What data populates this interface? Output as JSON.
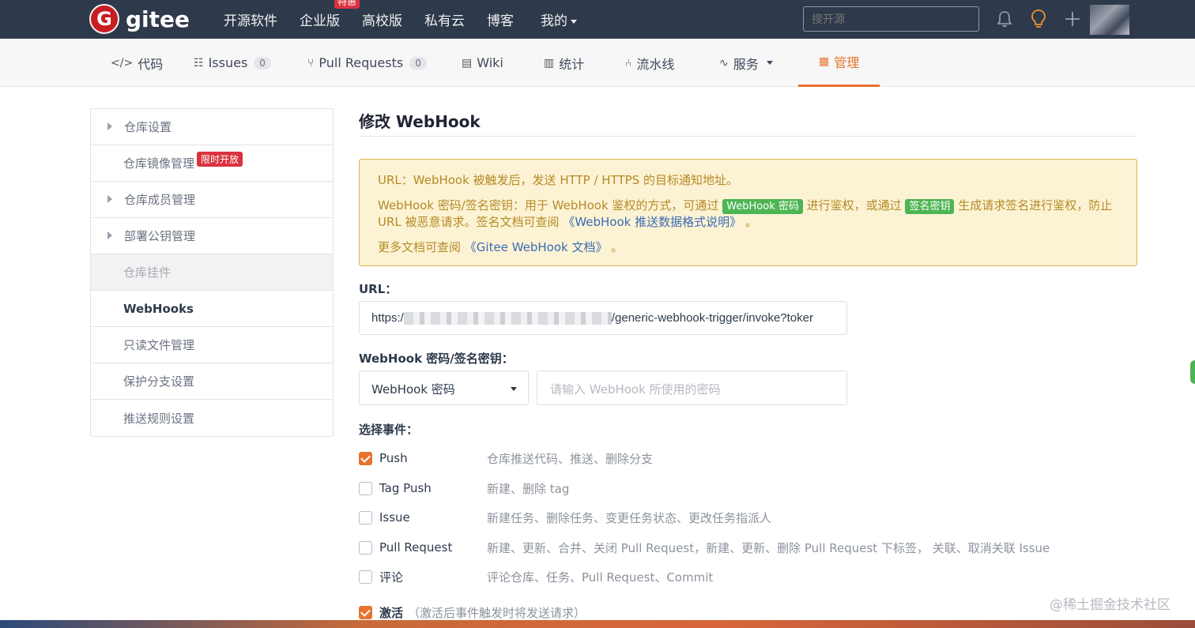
{
  "topbar": {
    "logo_letter": "G",
    "logo_text": "gitee",
    "nav": [
      "开源软件",
      "企业版",
      "高校版",
      "私有云",
      "博客",
      "我的"
    ],
    "hot_badge": "特惠",
    "search_placeholder": "搜开源"
  },
  "tabs": [
    {
      "icon": "</>",
      "label": "代码"
    },
    {
      "icon": "☷",
      "label": "Issues",
      "count": "0"
    },
    {
      "icon": "⑂",
      "label": "Pull Requests",
      "count": "0"
    },
    {
      "icon": "▤",
      "label": "Wiki"
    },
    {
      "icon": "▥",
      "label": "统计"
    },
    {
      "icon": "⑃",
      "label": "流水线"
    },
    {
      "icon": "∿",
      "label": "服务"
    },
    {
      "icon": "▦",
      "label": "管理"
    }
  ],
  "sidebar": {
    "items": [
      "仓库设置",
      "仓库镜像管理",
      "仓库成员管理",
      "部署公钥管理",
      "仓库挂件",
      "WebHooks",
      "只读文件管理",
      "保护分支设置",
      "推送规则设置"
    ],
    "limit_badge": "限时开放"
  },
  "main": {
    "title": "修改 WebHook",
    "notice": {
      "line1": "URL：WebHook 被触发后，发送 HTTP / HTTPS 的目标通知地址。",
      "line2_a": "WebHook 密码/签名密钥：用于 WebHook 鉴权的方式，可通过",
      "pill1": "WebHook 密码",
      "line2_b": "进行鉴权，或通过",
      "pill2": "签名密钥",
      "line2_c": "生成请求签名进行鉴权，防止 URL 被恶意请求。签名文档可查阅",
      "link1": "《WebHook 推送数据格式说明》",
      "line2_d": "。",
      "line3_a": "更多文档可查阅",
      "link2": "《Gitee WebHook 文档》",
      "line3_b": "。"
    },
    "url_label": "URL：",
    "url_prefix": "https:/",
    "url_suffix": "/generic-webhook-trigger/invoke?toker",
    "secret_label": "WebHook 密码/签名密钥：",
    "secret_type": "WebHook 密码",
    "secret_placeholder": "请输入 WebHook 所使用的密码",
    "events_label": "选择事件：",
    "events": [
      {
        "name": "Push",
        "desc": "仓库推送代码、推送、删除分支",
        "checked": true
      },
      {
        "name": "Tag Push",
        "desc": "新建、删除 tag",
        "checked": false
      },
      {
        "name": "Issue",
        "desc": "新建任务、删除任务、变更任务状态、更改任务指派人",
        "checked": false
      },
      {
        "name": "Pull Request",
        "desc": "新建、更新、合并、关闭 Pull Request，新建、更新、删除 Pull Request 下标签， 关联、取消关联 Issue",
        "checked": false
      },
      {
        "name": "评论",
        "desc": "评论仓库、任务、Pull Request、Commit",
        "checked": false
      }
    ],
    "activate_label": "激活",
    "activate_note": "（激活后事件触发时将发送请求）",
    "activate_checked": true
  },
  "watermark": "@稀土掘金技术社区",
  "colors": {
    "accent": "#e8732f",
    "topbar": "#2e3a4b",
    "notice_bg": "#fcf3d4",
    "brand": "#c71d23"
  }
}
